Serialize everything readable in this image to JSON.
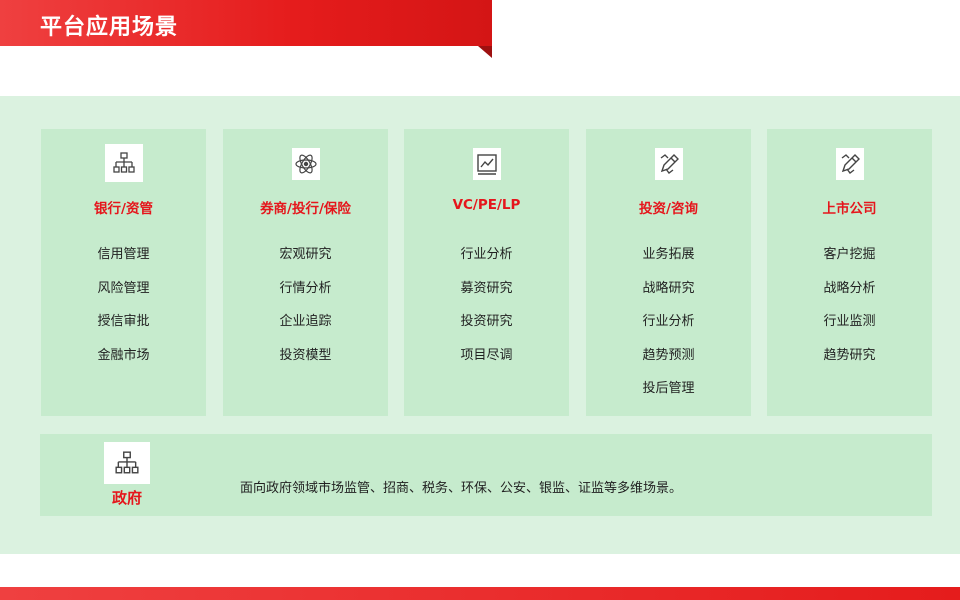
{
  "header": {
    "title": "平台应用场景"
  },
  "cards": [
    {
      "icon": "org-chart-icon",
      "title": "银行/资管",
      "items": [
        "信用管理",
        "风险管理",
        "授信审批",
        "金融市场"
      ]
    },
    {
      "icon": "atom-icon",
      "title": "券商/投行/保险",
      "items": [
        "宏观研究",
        "行情分析",
        "企业追踪",
        "投资模型"
      ]
    },
    {
      "icon": "line-chart-icon",
      "title": "VC/PE/LP",
      "items": [
        "行业分析",
        "募资研究",
        "投资研究",
        "项目尽调"
      ]
    },
    {
      "icon": "pencil-ruler-icon",
      "title": "投资/咨询",
      "items": [
        "业务拓展",
        "战略研究",
        "行业分析",
        "趋势预测",
        "投后管理"
      ]
    },
    {
      "icon": "pencil-ruler-icon",
      "title": "上市公司",
      "items": [
        "客户挖掘",
        "战略分析",
        "行业监测",
        "趋势研究"
      ]
    }
  ],
  "government": {
    "icon": "org-chart-icon",
    "title": "政府",
    "description": "面向政府领域市场监管、招商、税务、环保、公安、银监、证监等多维场景。"
  },
  "colors": {
    "accent": "#e5161c",
    "panel": "#dbf2e0",
    "card": "#c6ebcd"
  }
}
